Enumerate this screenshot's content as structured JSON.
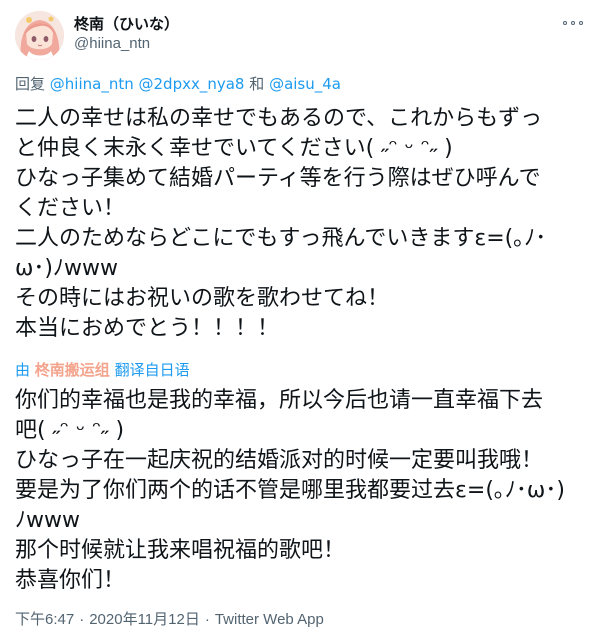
{
  "user": {
    "display_name": "柊南（ひいな）",
    "handle": "@hiina_ntn"
  },
  "icons": {
    "more": "more-options-icon",
    "avatar": "anime-girl-avatar"
  },
  "reply": {
    "prefix": "回复",
    "mention_1": "@hiina_ntn",
    "mention_2": "@2dpxx_nya8",
    "conjunction": "和",
    "mention_3": "@aisu_4a"
  },
  "tweet": {
    "lines": [
      "二人の幸せは私の幸せでもあるので、これからもずっ",
      "と仲良く末永く幸せでいてください( ˶ᵔ ᵕ ᵔ˶ )",
      "ひなっ子集めて結婚パーティ等を行う際はぜひ呼んで",
      "ください！",
      "二人のためならどこにでもすっ飛んでいきますε=(｡ﾉ･",
      "ω･)ﾉwww",
      "その時にはお祝いの歌を歌わせてね！",
      "本当におめでとう！！！！"
    ]
  },
  "translation": {
    "prefix": "由",
    "by_name": "柊南搬运组",
    "suffix": "翻译自日语",
    "lines": [
      "你们的幸福也是我的幸福，所以今后也请一直幸福下去",
      "吧( ˶ᵔ ᵕ ᵔ˶ )",
      "ひなっ子在一起庆祝的结婚派对的时候一定要叫我哦！",
      "要是为了你们两个的话不管是哪里我都要过去ε=(｡ﾉ･ω･)",
      "ﾉwww",
      "那个时候就让我来唱祝福的歌吧！",
      "恭喜你们！"
    ]
  },
  "meta": {
    "time": "下午6:47",
    "date": "2020年11月12日",
    "source": "Twitter Web App",
    "separator": "·"
  },
  "colors": {
    "link": "#1d9bf0",
    "secondary_text": "#536471",
    "translator_accent": "#f4a38c"
  }
}
